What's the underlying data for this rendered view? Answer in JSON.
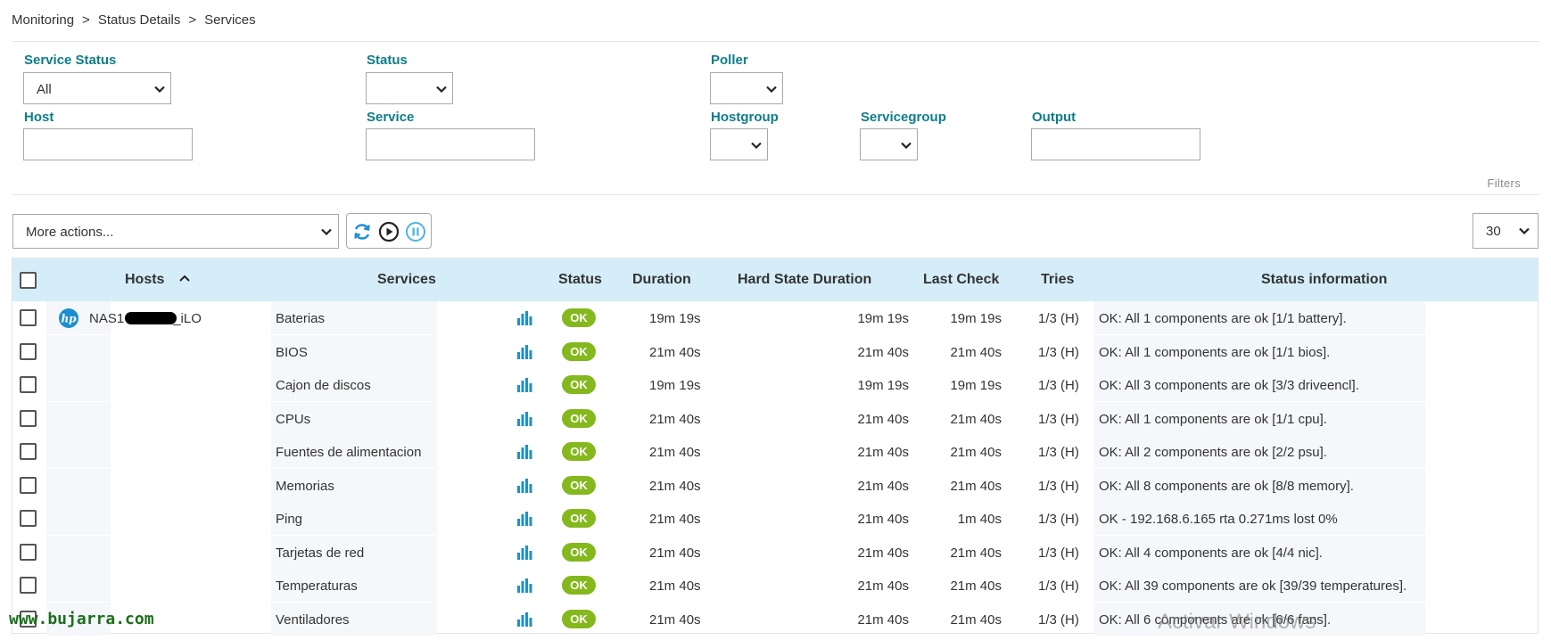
{
  "breadcrumb": [
    "Monitoring",
    "Status Details",
    "Services"
  ],
  "breadcrumb_sep": ">",
  "filters": {
    "service_status": {
      "label": "Service Status",
      "value": "All"
    },
    "status": {
      "label": "Status",
      "value": ""
    },
    "poller": {
      "label": "Poller",
      "value": ""
    },
    "host": {
      "label": "Host",
      "value": ""
    },
    "service": {
      "label": "Service",
      "value": ""
    },
    "hostgroup": {
      "label": "Hostgroup",
      "value": ""
    },
    "servicegroup": {
      "label": "Servicegroup",
      "value": ""
    },
    "output": {
      "label": "Output",
      "value": ""
    },
    "filters_link": "Filters"
  },
  "toolbar": {
    "more_actions": "More actions...",
    "per_page": "30"
  },
  "table": {
    "headers": {
      "hosts": "Hosts",
      "services": "Services",
      "status": "Status",
      "duration": "Duration",
      "hard_state_duration": "Hard State Duration",
      "last_check": "Last Check",
      "tries": "Tries",
      "status_information": "Status information"
    },
    "host_prefix": "NAS1",
    "host_suffix": "_iLO",
    "rows": [
      {
        "service": "Baterias",
        "status": "OK",
        "duration": "19m 19s",
        "hard": "19m 19s",
        "last": "19m 19s",
        "tries": "1/3 (H)",
        "info": "OK: All 1 components are ok [1/1 battery]."
      },
      {
        "service": "BIOS",
        "status": "OK",
        "duration": "21m 40s",
        "hard": "21m 40s",
        "last": "21m 40s",
        "tries": "1/3 (H)",
        "info": "OK: All 1 components are ok [1/1 bios]."
      },
      {
        "service": "Cajon de discos",
        "status": "OK",
        "duration": "19m 19s",
        "hard": "19m 19s",
        "last": "19m 19s",
        "tries": "1/3 (H)",
        "info": "OK: All 3 components are ok [3/3 driveencl]."
      },
      {
        "service": "CPUs",
        "status": "OK",
        "duration": "21m 40s",
        "hard": "21m 40s",
        "last": "21m 40s",
        "tries": "1/3 (H)",
        "info": "OK: All 1 components are ok [1/1 cpu]."
      },
      {
        "service": "Fuentes de alimentacion",
        "status": "OK",
        "duration": "21m 40s",
        "hard": "21m 40s",
        "last": "21m 40s",
        "tries": "1/3 (H)",
        "info": "OK: All 2 components are ok [2/2 psu]."
      },
      {
        "service": "Memorias",
        "status": "OK",
        "duration": "21m 40s",
        "hard": "21m 40s",
        "last": "21m 40s",
        "tries": "1/3 (H)",
        "info": "OK: All 8 components are ok [8/8 memory]."
      },
      {
        "service": "Ping",
        "status": "OK",
        "duration": "21m 40s",
        "hard": "21m 40s",
        "last": "1m 40s",
        "tries": "1/3 (H)",
        "info": "OK - 192.168.6.165 rta 0.271ms lost 0%"
      },
      {
        "service": "Tarjetas de red",
        "status": "OK",
        "duration": "21m 40s",
        "hard": "21m 40s",
        "last": "21m 40s",
        "tries": "1/3 (H)",
        "info": "OK: All 4 components are ok [4/4 nic]."
      },
      {
        "service": "Temperaturas",
        "status": "OK",
        "duration": "21m 40s",
        "hard": "21m 40s",
        "last": "21m 40s",
        "tries": "1/3 (H)",
        "info": "OK: All 39 components are ok [39/39 temperatures]."
      },
      {
        "service": "Ventiladores",
        "status": "OK",
        "duration": "21m 40s",
        "hard": "21m 40s",
        "last": "21m 40s",
        "tries": "1/3 (H)",
        "info": "OK: All 6 components are ok [6/6 fans]."
      }
    ]
  },
  "watermarks": {
    "site": "www.bujarra.com",
    "windows": "Activar Windows"
  },
  "colors": {
    "accent_label": "#0e7d8a",
    "header_bg": "#d5edf8",
    "ok_badge": "#84b81d",
    "icon_blue": "#1d8fd0"
  }
}
